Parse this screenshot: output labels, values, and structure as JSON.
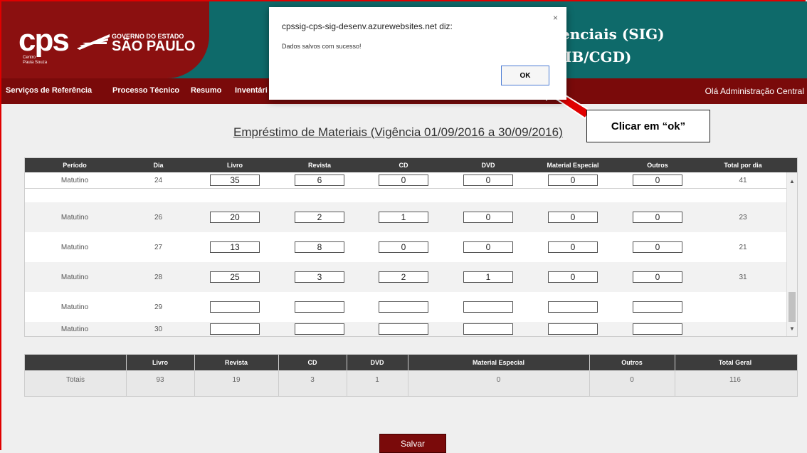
{
  "header": {
    "cps_logo": "cps",
    "cps_sub_line1": "Centro",
    "cps_sub_line2": "Paula Souza",
    "gov_top": "GOVERNO DO ESTADO",
    "gov_main": "SÃO PAULO",
    "system_title_line1": "enciais (SIG)",
    "system_title_line2": "IB/CGD)"
  },
  "nav": {
    "items": [
      "Serviços de Referência",
      "Processo Técnico",
      "Resumo",
      "Inventári"
    ],
    "greeting": "Olá Administração Central"
  },
  "page": {
    "title": "Empréstimo de Materiais (Vigência 01/09/2016 a 30/09/2016)",
    "callout": "Clicar em “ok”",
    "save_label": "Salvar"
  },
  "grid": {
    "columns": [
      "Período",
      "Dia",
      "Livro",
      "Revista",
      "CD",
      "DVD",
      "Material Especial",
      "Outros",
      "Total por dia"
    ],
    "rows": [
      {
        "periodo": "Matutino",
        "dia": "24",
        "livro": "35",
        "revista": "6",
        "cd": "0",
        "dvd": "0",
        "mat": "0",
        "outros": "0",
        "total": "41"
      },
      {
        "periodo": "Matutino",
        "dia": "26",
        "livro": "20",
        "revista": "2",
        "cd": "1",
        "dvd": "0",
        "mat": "0",
        "outros": "0",
        "total": "23"
      },
      {
        "periodo": "Matutino",
        "dia": "27",
        "livro": "13",
        "revista": "8",
        "cd": "0",
        "dvd": "0",
        "mat": "0",
        "outros": "0",
        "total": "21"
      },
      {
        "periodo": "Matutino",
        "dia": "28",
        "livro": "25",
        "revista": "3",
        "cd": "2",
        "dvd": "1",
        "mat": "0",
        "outros": "0",
        "total": "31"
      },
      {
        "periodo": "Matutino",
        "dia": "29",
        "livro": "",
        "revista": "",
        "cd": "",
        "dvd": "",
        "mat": "",
        "outros": "",
        "total": ""
      },
      {
        "periodo": "Matutino",
        "dia": "30",
        "livro": "",
        "revista": "",
        "cd": "",
        "dvd": "",
        "mat": "",
        "outros": "",
        "total": ""
      }
    ]
  },
  "totals": {
    "columns": [
      "Livro",
      "Revista",
      "CD",
      "DVD",
      "Material Especial",
      "Outros",
      "Total Geral"
    ],
    "row_label": "Totais",
    "values": [
      "93",
      "19",
      "3",
      "1",
      "0",
      "0",
      "116"
    ]
  },
  "dialog": {
    "title": "cpssig-cps-sig-desenv.azurewebsites.net diz:",
    "message": "Dados salvos com sucesso!",
    "ok_label": "OK",
    "close_label": "×"
  },
  "colors": {
    "brand_red": "#8b1010",
    "nav_red": "#7a0a0a",
    "header_teal": "#0e6a6a",
    "table_header": "#3c3c3c"
  }
}
